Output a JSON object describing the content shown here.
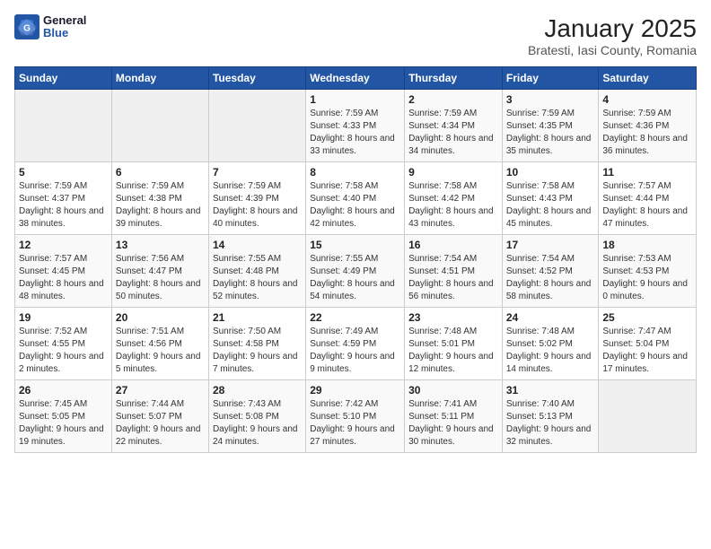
{
  "header": {
    "logo_line1": "General",
    "logo_line2": "Blue",
    "title": "January 2025",
    "subtitle": "Bratesti, Iasi County, Romania"
  },
  "weekdays": [
    "Sunday",
    "Monday",
    "Tuesday",
    "Wednesday",
    "Thursday",
    "Friday",
    "Saturday"
  ],
  "weeks": [
    [
      {
        "day": "",
        "info": ""
      },
      {
        "day": "",
        "info": ""
      },
      {
        "day": "",
        "info": ""
      },
      {
        "day": "1",
        "info": "Sunrise: 7:59 AM\nSunset: 4:33 PM\nDaylight: 8 hours and 33 minutes."
      },
      {
        "day": "2",
        "info": "Sunrise: 7:59 AM\nSunset: 4:34 PM\nDaylight: 8 hours and 34 minutes."
      },
      {
        "day": "3",
        "info": "Sunrise: 7:59 AM\nSunset: 4:35 PM\nDaylight: 8 hours and 35 minutes."
      },
      {
        "day": "4",
        "info": "Sunrise: 7:59 AM\nSunset: 4:36 PM\nDaylight: 8 hours and 36 minutes."
      }
    ],
    [
      {
        "day": "5",
        "info": "Sunrise: 7:59 AM\nSunset: 4:37 PM\nDaylight: 8 hours and 38 minutes."
      },
      {
        "day": "6",
        "info": "Sunrise: 7:59 AM\nSunset: 4:38 PM\nDaylight: 8 hours and 39 minutes."
      },
      {
        "day": "7",
        "info": "Sunrise: 7:59 AM\nSunset: 4:39 PM\nDaylight: 8 hours and 40 minutes."
      },
      {
        "day": "8",
        "info": "Sunrise: 7:58 AM\nSunset: 4:40 PM\nDaylight: 8 hours and 42 minutes."
      },
      {
        "day": "9",
        "info": "Sunrise: 7:58 AM\nSunset: 4:42 PM\nDaylight: 8 hours and 43 minutes."
      },
      {
        "day": "10",
        "info": "Sunrise: 7:58 AM\nSunset: 4:43 PM\nDaylight: 8 hours and 45 minutes."
      },
      {
        "day": "11",
        "info": "Sunrise: 7:57 AM\nSunset: 4:44 PM\nDaylight: 8 hours and 47 minutes."
      }
    ],
    [
      {
        "day": "12",
        "info": "Sunrise: 7:57 AM\nSunset: 4:45 PM\nDaylight: 8 hours and 48 minutes."
      },
      {
        "day": "13",
        "info": "Sunrise: 7:56 AM\nSunset: 4:47 PM\nDaylight: 8 hours and 50 minutes."
      },
      {
        "day": "14",
        "info": "Sunrise: 7:55 AM\nSunset: 4:48 PM\nDaylight: 8 hours and 52 minutes."
      },
      {
        "day": "15",
        "info": "Sunrise: 7:55 AM\nSunset: 4:49 PM\nDaylight: 8 hours and 54 minutes."
      },
      {
        "day": "16",
        "info": "Sunrise: 7:54 AM\nSunset: 4:51 PM\nDaylight: 8 hours and 56 minutes."
      },
      {
        "day": "17",
        "info": "Sunrise: 7:54 AM\nSunset: 4:52 PM\nDaylight: 8 hours and 58 minutes."
      },
      {
        "day": "18",
        "info": "Sunrise: 7:53 AM\nSunset: 4:53 PM\nDaylight: 9 hours and 0 minutes."
      }
    ],
    [
      {
        "day": "19",
        "info": "Sunrise: 7:52 AM\nSunset: 4:55 PM\nDaylight: 9 hours and 2 minutes."
      },
      {
        "day": "20",
        "info": "Sunrise: 7:51 AM\nSunset: 4:56 PM\nDaylight: 9 hours and 5 minutes."
      },
      {
        "day": "21",
        "info": "Sunrise: 7:50 AM\nSunset: 4:58 PM\nDaylight: 9 hours and 7 minutes."
      },
      {
        "day": "22",
        "info": "Sunrise: 7:49 AM\nSunset: 4:59 PM\nDaylight: 9 hours and 9 minutes."
      },
      {
        "day": "23",
        "info": "Sunrise: 7:48 AM\nSunset: 5:01 PM\nDaylight: 9 hours and 12 minutes."
      },
      {
        "day": "24",
        "info": "Sunrise: 7:48 AM\nSunset: 5:02 PM\nDaylight: 9 hours and 14 minutes."
      },
      {
        "day": "25",
        "info": "Sunrise: 7:47 AM\nSunset: 5:04 PM\nDaylight: 9 hours and 17 minutes."
      }
    ],
    [
      {
        "day": "26",
        "info": "Sunrise: 7:45 AM\nSunset: 5:05 PM\nDaylight: 9 hours and 19 minutes."
      },
      {
        "day": "27",
        "info": "Sunrise: 7:44 AM\nSunset: 5:07 PM\nDaylight: 9 hours and 22 minutes."
      },
      {
        "day": "28",
        "info": "Sunrise: 7:43 AM\nSunset: 5:08 PM\nDaylight: 9 hours and 24 minutes."
      },
      {
        "day": "29",
        "info": "Sunrise: 7:42 AM\nSunset: 5:10 PM\nDaylight: 9 hours and 27 minutes."
      },
      {
        "day": "30",
        "info": "Sunrise: 7:41 AM\nSunset: 5:11 PM\nDaylight: 9 hours and 30 minutes."
      },
      {
        "day": "31",
        "info": "Sunrise: 7:40 AM\nSunset: 5:13 PM\nDaylight: 9 hours and 32 minutes."
      },
      {
        "day": "",
        "info": ""
      }
    ]
  ]
}
